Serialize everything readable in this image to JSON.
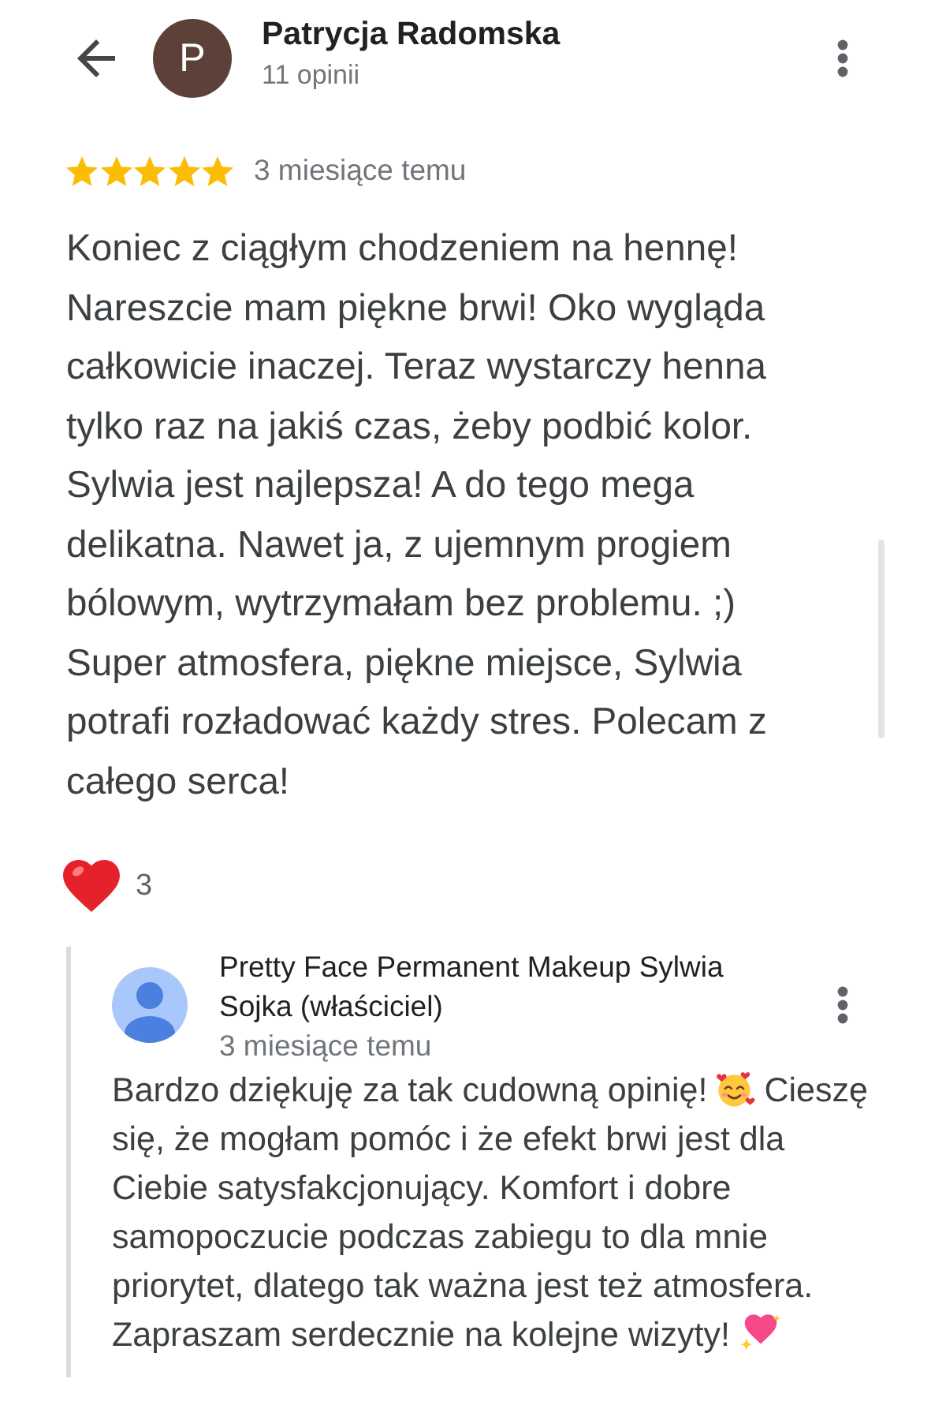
{
  "header": {
    "avatar_letter": "P",
    "author": "Patrycja Radomska",
    "reviews_count": "11 opinii"
  },
  "review": {
    "stars": 5,
    "time": "3 miesiące temu",
    "text": "Koniec z ciągłym chodzeniem na hennę!\nNareszcie mam piękne brwi! Oko wygląda\ncałkowicie inaczej. Teraz wystarczy henna\ntylko raz na jakiś czas, żeby podbić kolor.\nSylwia jest najlepsza! A do tego mega\ndelikatna. Nawet ja, z ujemnym progiem\nbólowym, wytrzymałam bez problemu. ;)\nSuper atmosfera, piękne miejsce, Sylwia\npotrafi rozładować każdy stres. Polecam z\ncałego serca!",
    "reactions": [
      {
        "kind": "heart",
        "count": "3"
      }
    ]
  },
  "owner_reply": {
    "author": "Pretty Face Permanent Makeup Sylwia Sojka (właściciel)",
    "time": "3 miesiące temu",
    "text_parts": [
      {
        "kind": "inline",
        "text": "Bardzo dziękuję za tak cudowną opinię!"
      },
      {
        "kind": "emoji"
      },
      {
        "kind": "inline",
        "text": "Cieszę"
      },
      {
        "kind": "block",
        "text": "się, że mogłam pomóc i że efekt brwi jest dla\nCiebie satysfakcjonujący. Komfort i dobre\nsamopoczucie podczas zabiegu to dla mnie\npriorytet, dlatego tak ważna jest też atmosfera."
      },
      {
        "kind": "inline",
        "text": "Zapraszam serdecznie na kolejne wizyty!"
      },
      {
        "kind": "emoji"
      }
    ]
  }
}
